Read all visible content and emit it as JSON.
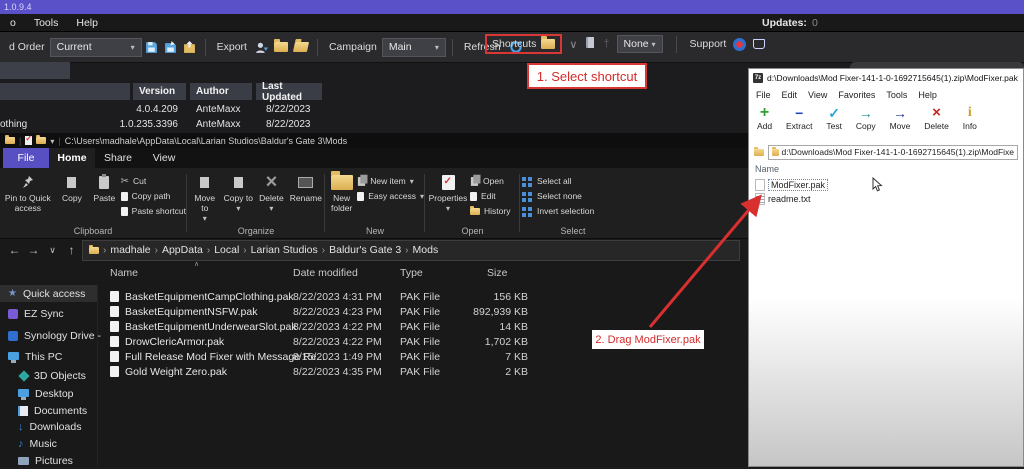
{
  "app": {
    "version": "1.0.9.4",
    "menu": {
      "partial": "o",
      "tools": "Tools",
      "help": "Help",
      "updates_label": "Updates:",
      "updates_count": "0"
    },
    "toolbar": {
      "load_order_label": "d Order",
      "load_order_value": "Current",
      "export_label": "Export",
      "campaign_label": "Campaign",
      "campaign_value": "Main",
      "refresh_label": "Refresh",
      "shortcuts_label": "Shortcuts",
      "none_label": "None",
      "support_label": "Support"
    },
    "table": {
      "col_version": "Version",
      "col_author": "Author",
      "col_updated": "Last Updated",
      "rows": [
        {
          "name_fragment": "",
          "version": "4.0.4.209",
          "author": "AnteMaxx",
          "updated": "8/22/2023"
        },
        {
          "name_fragment": "othing",
          "version": "1.0.235.3396",
          "author": "AnteMaxx",
          "updated": "8/22/2023"
        }
      ]
    }
  },
  "explorer": {
    "title_path": "C:\\Users\\madhale\\AppData\\Local\\Larian Studios\\Baldur's Gate 3\\Mods",
    "tabs": {
      "file": "File",
      "home": "Home",
      "share": "Share",
      "view": "View"
    },
    "ribbon": {
      "pin": "Pin to Quick access",
      "copy": "Copy",
      "paste": "Paste",
      "cut": "Cut",
      "copy_path": "Copy path",
      "paste_shortcut": "Paste shortcut",
      "move_to": "Move to",
      "copy_to": "Copy to",
      "delete": "Delete",
      "rename": "Rename",
      "new_folder": "New folder",
      "new_item": "New item",
      "easy_access": "Easy access",
      "properties": "Properties",
      "open": "Open",
      "edit": "Edit",
      "history": "History",
      "select_all": "Select all",
      "select_none": "Select none",
      "invert_selection": "Invert selection",
      "groups": {
        "clipboard": "Clipboard",
        "organize": "Organize",
        "new": "New",
        "open": "Open",
        "select": "Select"
      }
    },
    "breadcrumb": [
      "madhale",
      "AppData",
      "Local",
      "Larian Studios",
      "Baldur's Gate 3",
      "Mods"
    ],
    "columns": {
      "name": "Name",
      "date": "Date modified",
      "type": "Type",
      "size": "Size"
    },
    "sidebar": [
      {
        "label": "Quick access"
      },
      {
        "label": "EZ Sync"
      },
      {
        "label": "Synology Drive -"
      },
      {
        "label": "This PC"
      },
      {
        "label": "3D Objects"
      },
      {
        "label": "Desktop"
      },
      {
        "label": "Documents"
      },
      {
        "label": "Downloads"
      },
      {
        "label": "Music"
      },
      {
        "label": "Pictures"
      }
    ],
    "files": [
      {
        "name": "BasketEquipmentCampClothing.pak",
        "date": "8/22/2023 4:31 PM",
        "type": "PAK File",
        "size": "156 KB"
      },
      {
        "name": "BasketEquipmentNSFW.pak",
        "date": "8/22/2023 4:23 PM",
        "type": "PAK File",
        "size": "892,939 KB"
      },
      {
        "name": "BasketEquipmentUnderwearSlot.pak",
        "date": "8/22/2023 4:22 PM",
        "type": "PAK File",
        "size": "14 KB"
      },
      {
        "name": "DrowClericArmor.pak",
        "date": "8/22/2023 4:22 PM",
        "type": "PAK File",
        "size": "1,702 KB"
      },
      {
        "name": "Full Release Mod Fixer with Message Re...",
        "date": "8/15/2023 1:49 PM",
        "type": "PAK File",
        "size": "7 KB"
      },
      {
        "name": "Gold Weight Zero.pak",
        "date": "8/22/2023 4:35 PM",
        "type": "PAK File",
        "size": "2 KB"
      }
    ]
  },
  "sevenzip": {
    "title": "d:\\Downloads\\Mod Fixer-141-1-0-1692715645(1).zip\\ModFixer.pak",
    "menu": [
      "File",
      "Edit",
      "View",
      "Favorites",
      "Tools",
      "Help"
    ],
    "buttons": [
      "Add",
      "Extract",
      "Test",
      "Copy",
      "Move",
      "Delete",
      "Info"
    ],
    "address": "d:\\Downloads\\Mod Fixer-141-1-0-1692715645(1).zip\\ModFixe",
    "column_name": "Name",
    "files": [
      {
        "name": "ModFixer.pak"
      },
      {
        "name": "readme.txt"
      }
    ]
  },
  "annotations": {
    "step1": "1. Select shortcut",
    "step2": "2. Drag ModFixer.pak"
  },
  "colors": {
    "accent_purple": "#5a50c8",
    "annotation_red": "#d93636",
    "selection_blue": "#4a90d9",
    "folder_yellow": "#e8c069"
  }
}
